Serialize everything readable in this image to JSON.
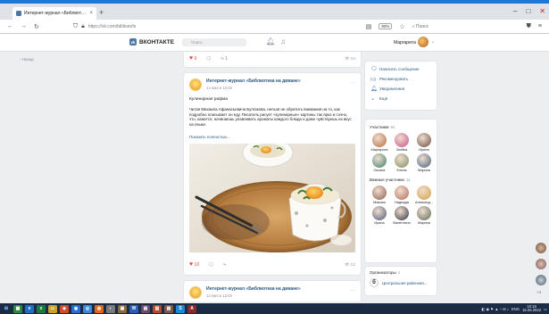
{
  "browser": {
    "tab_title": "Интернет-журнал «Библиот…",
    "url": "https://vk.com/biblioeofs",
    "zoom": "90%",
    "search_placeholder": "Поиск",
    "new_tab_glyph": "+",
    "close_glyph": "×"
  },
  "vk": {
    "logo": "ВКОНТАКТЕ",
    "search_placeholder": "Поиск",
    "user_name": "Маргарита",
    "back_link": "Назад"
  },
  "top_post": {
    "likes": "9",
    "shares": "1",
    "views": "53"
  },
  "post": {
    "group_name": "Интернет-журнал «Библиотека на диване»",
    "date": "14 мая в 12:00",
    "heading": "Кулинарная рифма",
    "body": "Читая Михаила Афанасьевича Булгакова, нельзя не обратить внимания на то, как подробно описывает он еду. Писатель рисует «кулинарные» картины так ярко и сочно, что, кажется, начинаешь улавливать ароматы каждого блюда и даже чувствуешь их вкус на языке.",
    "show_more": "Показать полностью...",
    "likes": "10",
    "views": "52"
  },
  "next_post": {
    "group_name": "Интернет-журнал «Библиотека на диване»",
    "date": "13 мая в 12:00"
  },
  "menu": [
    {
      "icon": "message-icon",
      "label": "Написать сообщение"
    },
    {
      "icon": "like-icon",
      "label": "Рекомендовать"
    },
    {
      "icon": "bell-icon",
      "label": "Уведомления"
    },
    {
      "icon": "more-icon",
      "label": "Ещё"
    }
  ],
  "members": {
    "title": "Участники",
    "count": "91",
    "list": [
      {
        "name": "Маргарита",
        "color": "#b86a3a"
      },
      {
        "name": "Злейка",
        "color": "#c94f8a"
      },
      {
        "name": "Ирина",
        "color": "#6b4b3e"
      },
      {
        "name": "Оксана",
        "color": "#3d7f6e"
      },
      {
        "name": "Елена",
        "color": "#7f8b5c"
      },
      {
        "name": "Марина",
        "color": "#44607a"
      }
    ]
  },
  "important": {
    "title": "Важные участники",
    "count": "11",
    "list": [
      {
        "name": "Максим",
        "color": "#8a5d4c"
      },
      {
        "name": "Надежда",
        "color": "#b36b55"
      },
      {
        "name": "Александ...",
        "color": "#d4a03f"
      },
      {
        "name": "Ирина",
        "color": "#4c5a7a"
      },
      {
        "name": "Валентина",
        "color": "#2f3440"
      },
      {
        "name": "Марина",
        "color": "#5a6a57"
      }
    ]
  },
  "organizers": {
    "title": "Организаторы",
    "count": "1",
    "name": "Центральная районная...",
    "logo_letter": "б"
  },
  "side_more": "+4",
  "tray": {
    "lang": "ENG",
    "time": "10:18",
    "date": "15.05.2022"
  }
}
